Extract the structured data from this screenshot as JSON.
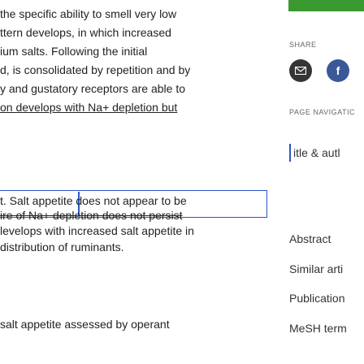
{
  "article": {
    "lines": [
      "the specific ability to smell very low",
      "ttern develops, in which increased",
      "ium salts. Following the initial",
      "d, is consolidated by repetition and by",
      "y and gustatory receptors are able to",
      "on develops with Na+ depletion but",
      "t. Salt appetite does not appear to be",
      "ire of Na+ depletion does not persist",
      "levelops with increased salt appetite in",
      " distribution of ruminants."
    ],
    "section_heading": "salt appetite assessed by operant"
  },
  "sidebar": {
    "share_label": "SHARE",
    "share_icons": [
      "email-icon",
      "facebook-icon"
    ],
    "page_nav_label": "PAGE NAVIGATIC",
    "nav_items": [
      "itle & autl",
      "Abstract",
      "Similar arti",
      "Publication",
      "MeSH term"
    ]
  },
  "colors": {
    "accent": "#2a56c6",
    "topbar": "#3a9a2f",
    "facebook": "#3b5998",
    "email": "#353535"
  }
}
